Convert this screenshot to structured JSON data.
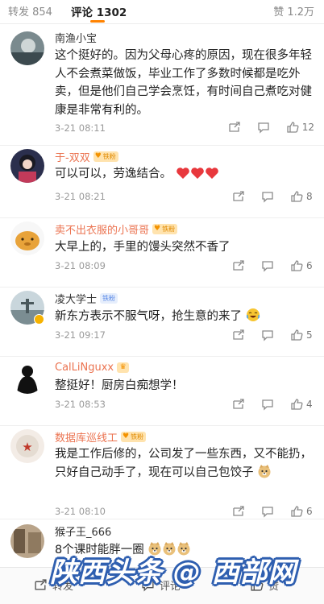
{
  "tabs": {
    "repost": "转发 854",
    "comment": "评论 1302",
    "like": "赞 1.2万",
    "accent_color": "#ff8200"
  },
  "comments": [
    {
      "name": "南渔小宝",
      "text": "这个挺好的。因为父母心疼的原因，现在很多年轻人不会煮菜做饭，毕业工作了多数时候都是吃外卖，但是他们自己学会烹饪，有时间自己煮吃对健康是非常有利的。",
      "time": "3-21 08:11",
      "likes": "12"
    },
    {
      "name": "于-双双",
      "fan_badge": "铁粉",
      "text": "可以可以，劳逸结合。",
      "emojis": [
        "red-heart",
        "red-heart",
        "red-heart"
      ],
      "time": "3-21 08:21",
      "likes": "8"
    },
    {
      "name": "卖不出衣服的小哥哥",
      "fan_badge": "铁粉",
      "text": "大早上的，手里的馒头突然不香了",
      "time": "3-21 08:09",
      "likes": "6"
    },
    {
      "name": "凌大学士",
      "member_badge": "铁粉",
      "text": "新东方表示不服气呀，抢生意的来了",
      "emojis": [
        "laugh-cry"
      ],
      "time": "3-21 09:17",
      "likes": "5"
    },
    {
      "name": "CalLiNguxx",
      "text": "整挺好！厨房白痴想学！",
      "time": "3-21 08:53",
      "likes": "4"
    },
    {
      "name": "数据库巡线工",
      "fan_badge": "铁粉",
      "text": "我是工作后修的，公司发了一些东西，又不能扔，只好自己动手了，现在可以自己包饺子",
      "emojis": [
        "doge"
      ],
      "time": "3-21 08:10",
      "likes": "6"
    },
    {
      "name": "猴子王_666",
      "text": "8个课时能胖一圈",
      "emojis": [
        "doge",
        "doge",
        "doge"
      ]
    }
  ],
  "bottom": {
    "repost": "转发",
    "comment": "评论",
    "like": "赞"
  },
  "watermark": "陕西头条 @ 西部网",
  "colors": {
    "name_highlight": "#eb7350",
    "fan_badge_bg": "#ffe3ae",
    "watermark_outline": "#2f5fb0"
  }
}
